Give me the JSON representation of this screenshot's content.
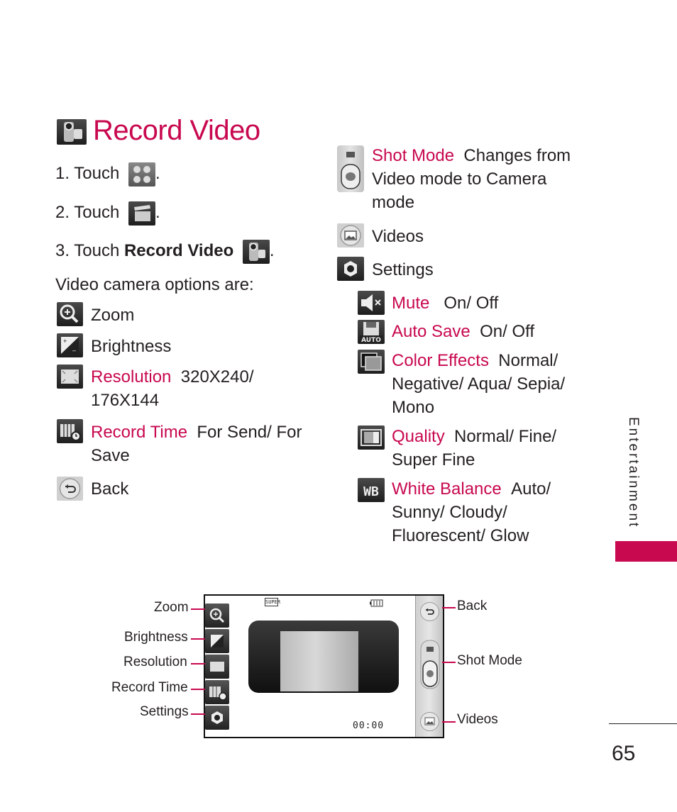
{
  "page": {
    "title": "Record Video",
    "section_tab": "Entertainment",
    "page_number": "65",
    "accent_color": "#c8084f"
  },
  "steps": [
    {
      "prefix": "1. Touch",
      "bold": "",
      "icon": "menu-grid-icon",
      "suffix": "."
    },
    {
      "prefix": "2. Touch",
      "bold": "",
      "icon": "clapperboard-icon",
      "suffix": "."
    },
    {
      "prefix": "3. Touch",
      "bold": "Record Video",
      "icon": "video-camera-icon",
      "suffix": "."
    }
  ],
  "options_intro": "Video camera options are:",
  "left_options": [
    {
      "icon": "zoom-icon",
      "label": "Zoom",
      "desc": "",
      "desc2": ""
    },
    {
      "icon": "brightness-icon",
      "label": "Brightness",
      "desc": "",
      "desc2": ""
    },
    {
      "icon": "resolution-icon",
      "label": "Resolution",
      "desc": "320X240/",
      "desc2": "176X144"
    },
    {
      "icon": "record-time-icon",
      "label": "Record Time",
      "desc": "For Send/ For",
      "desc2": "Save"
    },
    {
      "icon": "back-icon",
      "label": "Back",
      "desc": "",
      "desc2": ""
    }
  ],
  "right_options": [
    {
      "icon": "shot-mode-icon",
      "label": "Shot Mode",
      "desc": "Changes from",
      "desc2": "Video mode to Camera",
      "desc3": "mode"
    },
    {
      "icon": "videos-icon",
      "label": "Videos"
    },
    {
      "icon": "settings-icon",
      "label": "Settings"
    }
  ],
  "settings_options": [
    {
      "icon": "mute-icon",
      "label": "Mute",
      "desc": "On/ Off"
    },
    {
      "icon": "auto-save-icon",
      "label": "Auto Save",
      "desc": "On/ Off"
    },
    {
      "icon": "color-effects-icon",
      "label": "Color Effects",
      "desc": "Normal/",
      "desc2": "Negative/ Aqua/ Sepia/",
      "desc3": "Mono"
    },
    {
      "icon": "quality-icon",
      "label": "Quality",
      "desc": "Normal/ Fine/",
      "desc2": "Super Fine"
    },
    {
      "icon": "white-balance-icon",
      "label": "White Balance",
      "desc": "Auto/",
      "desc2": "Sunny/ Cloudy/",
      "desc3": "Fluorescent/ Glow"
    }
  ],
  "icon_glyphs": {
    "white_balance": "WB",
    "auto_save": "AUTO"
  },
  "diagram": {
    "left_callouts": [
      "Zoom",
      "Brightness",
      "Resolution",
      "Record Time",
      "Settings"
    ],
    "right_callouts": [
      "Back",
      "Shot Mode",
      "Videos"
    ],
    "quality_badge": "SUPER",
    "timer": "00:00"
  }
}
